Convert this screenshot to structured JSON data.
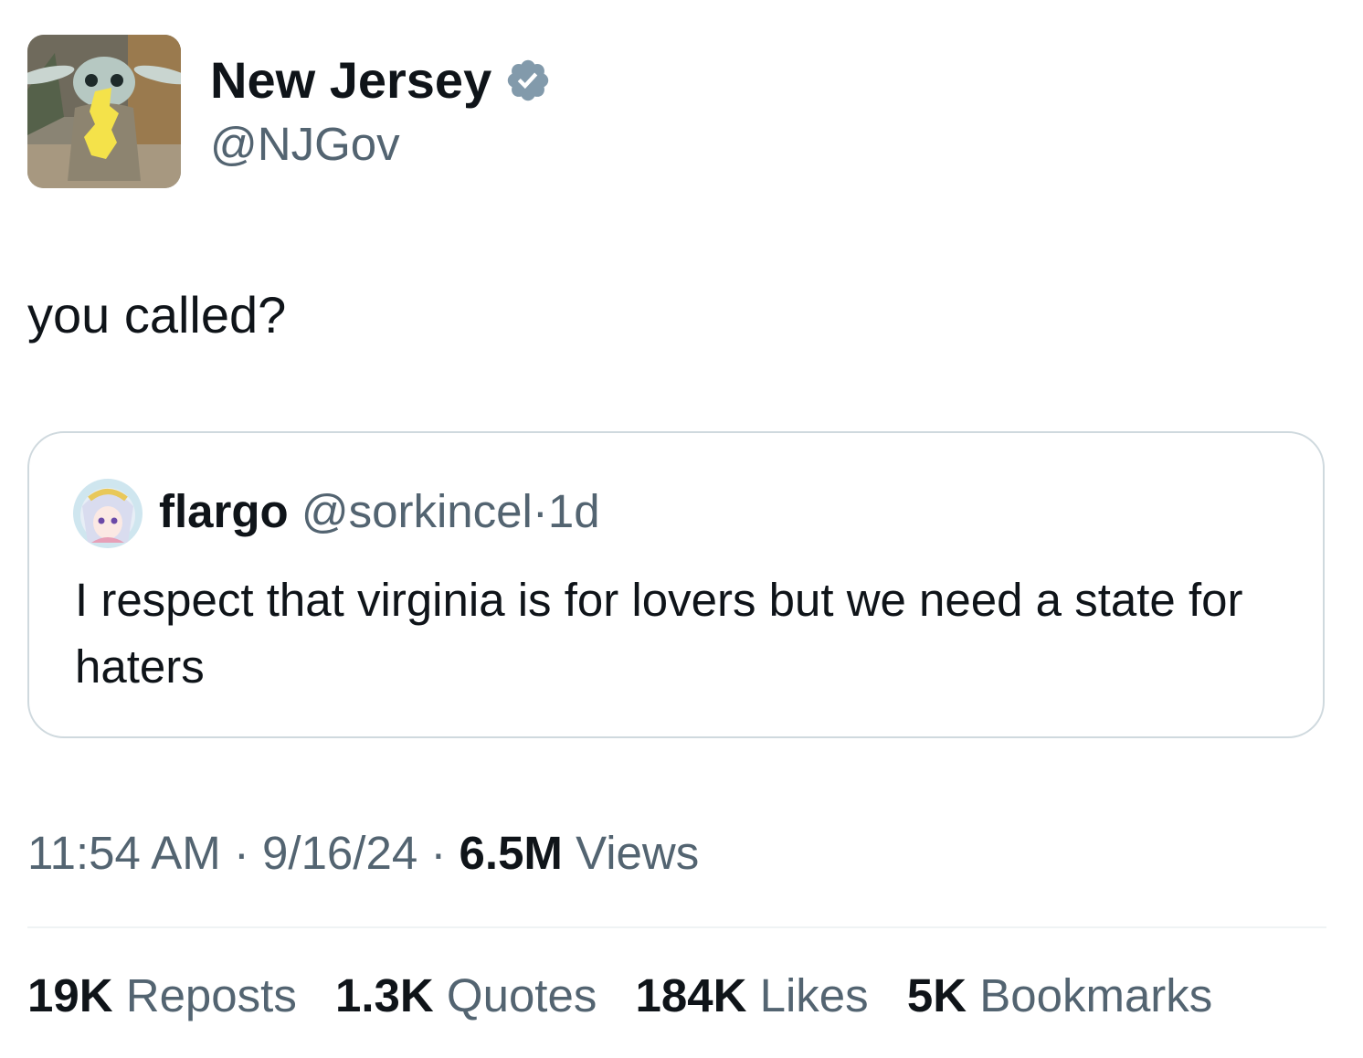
{
  "tweet": {
    "author": {
      "display_name": "New Jersey",
      "handle": "@NJGov",
      "verified": true,
      "avatar_icon": "baby-yoda-holding-new-jersey-avatar"
    },
    "text": "you called?",
    "quoted": {
      "display_name": "flargo",
      "handle": "@sorkincel",
      "separator": "·",
      "age": "1d",
      "avatar_icon": "anime-character-avatar",
      "text": "I respect that virginia is for lovers but we need a state for haters"
    },
    "meta": {
      "time": "11:54 AM",
      "separator": "·",
      "date": "9/16/24",
      "views_count": "6.5M",
      "views_label": "Views"
    },
    "stats": [
      {
        "count": "19K",
        "label": "Reposts"
      },
      {
        "count": "1.3K",
        "label": "Quotes"
      },
      {
        "count": "184K",
        "label": "Likes"
      },
      {
        "count": "5K",
        "label": "Bookmarks"
      }
    ]
  },
  "colors": {
    "text_primary": "#0f1419",
    "text_secondary": "#536471",
    "border": "#cfd9de",
    "verified_badge": "#829aab"
  }
}
